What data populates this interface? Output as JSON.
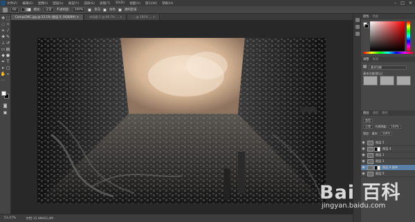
{
  "menubar": {
    "items": [
      "文件(F)",
      "编辑(E)",
      "图像(I)",
      "图层(L)",
      "类型(Y)",
      "选择(S)",
      "滤镜(T)",
      "3D(D)",
      "视图(V)",
      "窗口(W)",
      "帮助(H)"
    ],
    "window_controls": [
      "–",
      "□",
      "×"
    ]
  },
  "options": {
    "brush_size": "60",
    "mode_label": "模式:",
    "mode_value": "正常",
    "opacity_label": "不透明度:",
    "opacity_value": "100%",
    "reverse_label": "反向",
    "dither_label": "仿色",
    "transparency_label": "透明区域"
  },
  "tabs": [
    {
      "label": "Comps2NC.jpg @ 53.1% (图层 0, RGB/8#) ×",
      "active": true
    },
    {
      "label": "未标题-1 @ 66.7% ... ×",
      "active": false
    },
    {
      "label": "... @ 100% ... ×",
      "active": false
    }
  ],
  "status": {
    "zoom": "53.47%",
    "doc": "文档:15.9M/63.4M"
  },
  "panels": {
    "color_tabs": [
      "颜色",
      "色板"
    ],
    "adjust_tabs": [
      "调整",
      "样式"
    ],
    "preset_value": "基本功能",
    "preset_label": "基本功能(默认)",
    "layers_tabs": [
      "图层",
      "通道",
      "路径"
    ],
    "kind_label": "类型",
    "blend_mode": "正常",
    "opacity_label": "不透明度:",
    "opacity_value": "100%",
    "lock_label": "锁定:",
    "fill_label": "填充:",
    "fill_value": "100%",
    "layers": [
      {
        "name": "图层 5",
        "selected": false,
        "mask": false
      },
      {
        "name": "图层 4",
        "selected": false,
        "mask": true
      },
      {
        "name": "图层 1",
        "selected": false,
        "mask": false
      },
      {
        "name": "图层 3",
        "selected": false,
        "mask": false
      },
      {
        "name": "图层 0 副本",
        "selected": true,
        "mask": true
      },
      {
        "name": "图层 0",
        "selected": false,
        "mask": false
      }
    ],
    "footer_icons": [
      "link-icon",
      "fx-icon",
      "mask-icon",
      "adjustment-icon",
      "folder-icon",
      "new-layer-icon",
      "trash-icon"
    ]
  },
  "watermark": {
    "logo": "Bai 百科",
    "url": "jingyan.baidu.com"
  },
  "colors": {
    "sky": "#d9bba0",
    "city_dark": "#1a1a1a",
    "selected_layer": "#5b7ea5"
  }
}
